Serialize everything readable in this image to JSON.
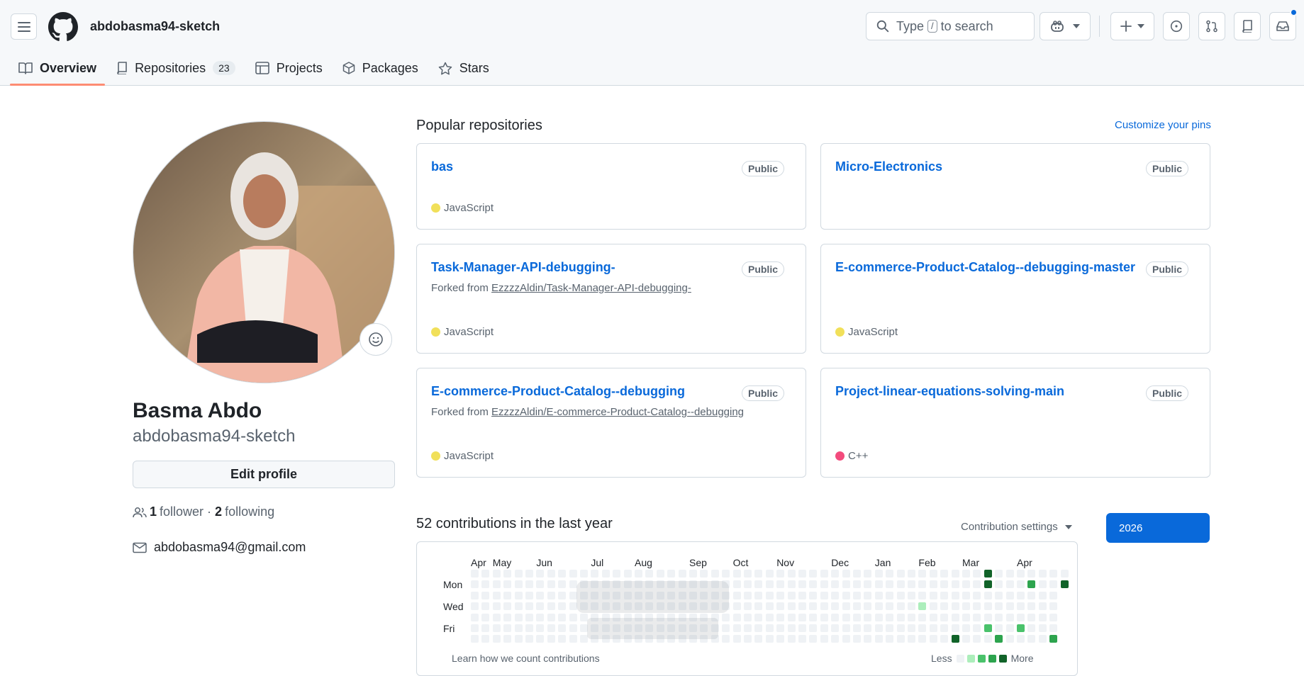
{
  "header": {
    "username": "abdobasma94-sketch",
    "search_placeholder_before": "Type",
    "search_key": "/",
    "search_placeholder_after": "to search"
  },
  "tabs": [
    {
      "label": "Overview",
      "active": true
    },
    {
      "label": "Repositories",
      "count": "23"
    },
    {
      "label": "Projects"
    },
    {
      "label": "Packages"
    },
    {
      "label": "Stars"
    }
  ],
  "profile": {
    "full_name": "Basma Abdo",
    "login": "abdobasma94-sketch",
    "edit_label": "Edit profile",
    "followers_count": "1",
    "followers_label": "follower",
    "separator": "·",
    "following_count": "2",
    "following_label": "following",
    "email": "abdobasma94@gmail.com"
  },
  "popular": {
    "title": "Popular repositories",
    "customize_label": "Customize your pins",
    "repos": [
      {
        "name": "bas",
        "visibility": "Public",
        "forked_prefix": "",
        "forked_from": "",
        "language": "JavaScript",
        "lang_color": "#f1e05a"
      },
      {
        "name": "Micro-Electronics",
        "visibility": "Public",
        "forked_prefix": "",
        "forked_from": "",
        "language": "",
        "lang_color": ""
      },
      {
        "name": "Task-Manager-API-debugging-",
        "visibility": "Public",
        "forked_prefix": "Forked from",
        "forked_from": "EzzzzAldin/Task-Manager-API-debugging-",
        "language": "JavaScript",
        "lang_color": "#f1e05a"
      },
      {
        "name": "E-commerce-Product-Catalog--debugging-master",
        "visibility": "Public",
        "forked_prefix": "",
        "forked_from": "",
        "language": "JavaScript",
        "lang_color": "#f1e05a"
      },
      {
        "name": "E-commerce-Product-Catalog--debugging",
        "visibility": "Public",
        "forked_prefix": "Forked from",
        "forked_from": "EzzzzAldin/E-commerce-Product-Catalog--debugging",
        "language": "JavaScript",
        "lang_color": "#f1e05a"
      },
      {
        "name": "Project-linear-equations-solving-main",
        "visibility": "Public",
        "forked_prefix": "",
        "forked_from": "",
        "language": "C++",
        "lang_color": "#f34b7d"
      }
    ]
  },
  "contributions": {
    "title": "52 contributions in the last year",
    "settings_label": "Contribution settings",
    "year": "2026",
    "months": [
      "Apr",
      "May",
      "Jun",
      "Jul",
      "Aug",
      "Sep",
      "Oct",
      "Nov",
      "Dec",
      "Jan",
      "Feb",
      "Mar",
      "Apr"
    ],
    "days": [
      "Mon",
      "Wed",
      "Fri"
    ],
    "learn_label": "Learn how we count contributions",
    "legend_less": "Less",
    "legend_more": "More",
    "level_colors": [
      "#eff2f5",
      "#aceebb",
      "#4ac26b",
      "#2da44e",
      "#116329"
    ],
    "levels_by_week": [
      [
        0,
        0,
        0,
        0,
        0,
        0,
        0
      ],
      [
        0,
        0,
        0,
        0,
        0,
        0,
        0
      ],
      [
        0,
        0,
        0,
        0,
        0,
        0,
        0
      ],
      [
        0,
        0,
        0,
        0,
        0,
        0,
        0
      ],
      [
        0,
        0,
        0,
        0,
        0,
        0,
        0
      ],
      [
        0,
        0,
        0,
        0,
        0,
        0,
        0
      ],
      [
        0,
        0,
        0,
        0,
        0,
        0,
        0
      ],
      [
        0,
        0,
        0,
        0,
        0,
        0,
        0
      ],
      [
        0,
        0,
        0,
        0,
        0,
        0,
        0
      ],
      [
        0,
        0,
        0,
        0,
        0,
        0,
        0
      ],
      [
        0,
        0,
        0,
        0,
        0,
        0,
        0
      ],
      [
        0,
        0,
        0,
        0,
        0,
        0,
        0
      ],
      [
        0,
        0,
        0,
        0,
        0,
        0,
        0
      ],
      [
        0,
        0,
        0,
        0,
        0,
        0,
        0
      ],
      [
        0,
        0,
        0,
        0,
        0,
        0,
        0
      ],
      [
        0,
        0,
        0,
        0,
        0,
        0,
        0
      ],
      [
        0,
        0,
        0,
        0,
        0,
        0,
        0
      ],
      [
        0,
        0,
        0,
        0,
        0,
        0,
        0
      ],
      [
        0,
        0,
        0,
        0,
        0,
        0,
        0
      ],
      [
        0,
        0,
        0,
        0,
        0,
        0,
        0
      ],
      [
        0,
        0,
        0,
        0,
        0,
        0,
        0
      ],
      [
        0,
        0,
        0,
        0,
        0,
        0,
        0
      ],
      [
        0,
        0,
        0,
        0,
        0,
        0,
        0
      ],
      [
        0,
        0,
        0,
        0,
        0,
        0,
        0
      ],
      [
        0,
        0,
        0,
        0,
        0,
        0,
        0
      ],
      [
        0,
        0,
        0,
        0,
        0,
        0,
        0
      ],
      [
        0,
        0,
        0,
        0,
        0,
        0,
        0
      ],
      [
        0,
        0,
        0,
        0,
        0,
        0,
        0
      ],
      [
        0,
        0,
        0,
        0,
        0,
        0,
        0
      ],
      [
        0,
        0,
        0,
        0,
        0,
        0,
        0
      ],
      [
        0,
        0,
        0,
        0,
        0,
        0,
        0
      ],
      [
        0,
        0,
        0,
        0,
        0,
        0,
        0
      ],
      [
        0,
        0,
        0,
        0,
        0,
        0,
        0
      ],
      [
        0,
        0,
        0,
        0,
        0,
        0,
        0
      ],
      [
        0,
        0,
        0,
        0,
        0,
        0,
        0
      ],
      [
        0,
        0,
        0,
        0,
        0,
        0,
        0
      ],
      [
        0,
        0,
        0,
        0,
        0,
        0,
        0
      ],
      [
        0,
        0,
        0,
        0,
        0,
        0,
        0
      ],
      [
        0,
        0,
        0,
        0,
        0,
        0,
        0
      ],
      [
        0,
        0,
        0,
        0,
        0,
        0,
        0
      ],
      [
        0,
        0,
        0,
        0,
        0,
        0,
        0
      ],
      [
        0,
        0,
        0,
        1,
        0,
        0,
        0
      ],
      [
        0,
        0,
        0,
        0,
        0,
        0,
        0
      ],
      [
        0,
        0,
        0,
        0,
        0,
        0,
        0
      ],
      [
        0,
        0,
        0,
        0,
        0,
        0,
        4
      ],
      [
        0,
        0,
        0,
        0,
        0,
        0,
        0
      ],
      [
        0,
        0,
        0,
        0,
        0,
        0,
        0
      ],
      [
        4,
        4,
        0,
        0,
        0,
        2,
        0
      ],
      [
        0,
        0,
        0,
        0,
        0,
        0,
        3
      ],
      [
        0,
        0,
        0,
        0,
        0,
        0,
        0
      ],
      [
        0,
        0,
        0,
        0,
        0,
        2,
        0
      ],
      [
        0,
        3,
        0,
        0,
        0,
        0,
        0
      ],
      [
        0,
        0,
        0,
        0,
        0,
        0,
        0
      ],
      [
        0,
        0,
        0,
        0,
        0,
        0,
        3
      ],
      [
        0,
        4
      ]
    ]
  }
}
